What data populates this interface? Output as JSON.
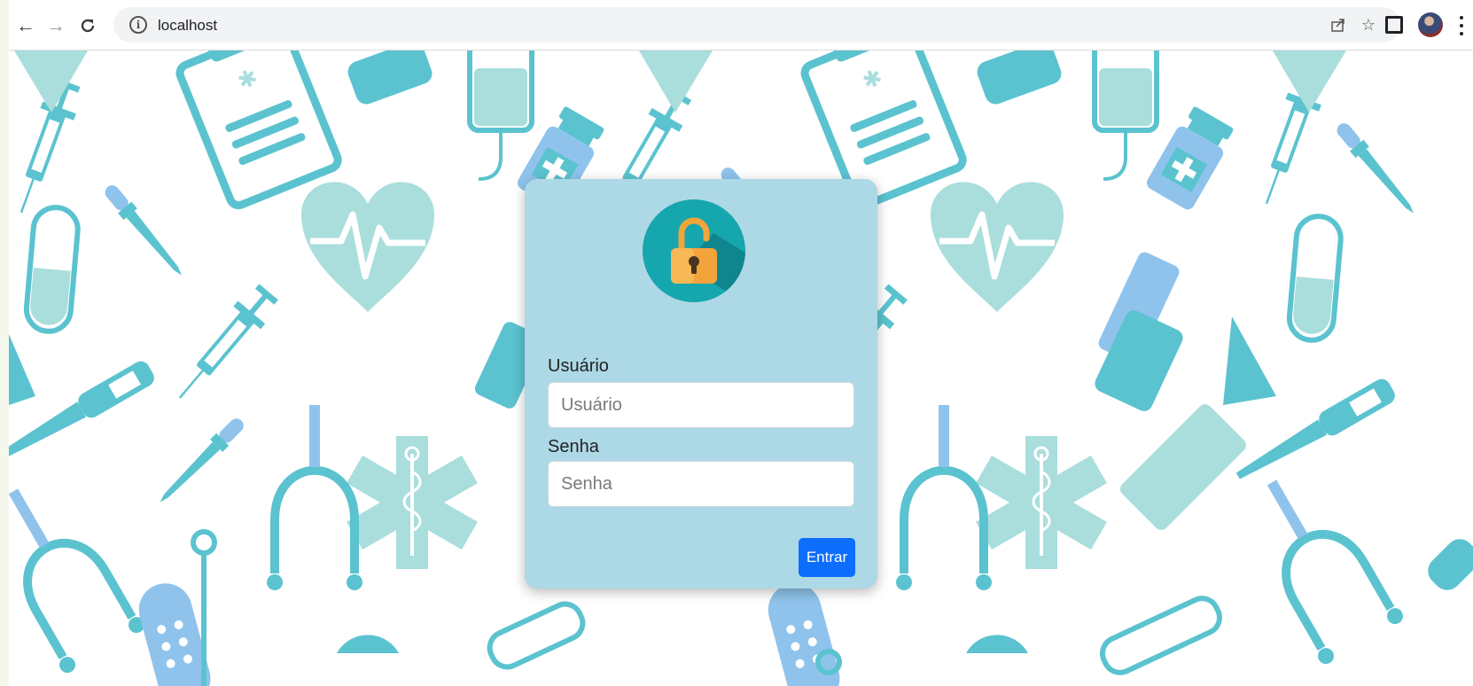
{
  "browser": {
    "nav_icons": [
      "back-arrow-icon",
      "forward-arrow-icon",
      "reload-icon"
    ],
    "url": "localhost",
    "toolbar_icons": [
      "site-info-icon",
      "share-icon",
      "bookmark-star-icon",
      "side-panel-icon",
      "profile-avatar",
      "menu-icon"
    ]
  },
  "page": {
    "background_theme": "medical icon pattern",
    "colors": {
      "pattern_teal": "#5bc3cf",
      "pattern_mint": "#a9dedc",
      "pattern_blue": "#8fc3ec",
      "card_background": "#add8e6",
      "button_primary": "#0d6efd"
    }
  },
  "login": {
    "icon": "unlocked-padlock-icon",
    "username": {
      "label": "Usuário",
      "placeholder": "Usuário",
      "value": ""
    },
    "password": {
      "label": "Senha",
      "placeholder": "Senha",
      "value": ""
    },
    "submit_label": "Entrar"
  }
}
